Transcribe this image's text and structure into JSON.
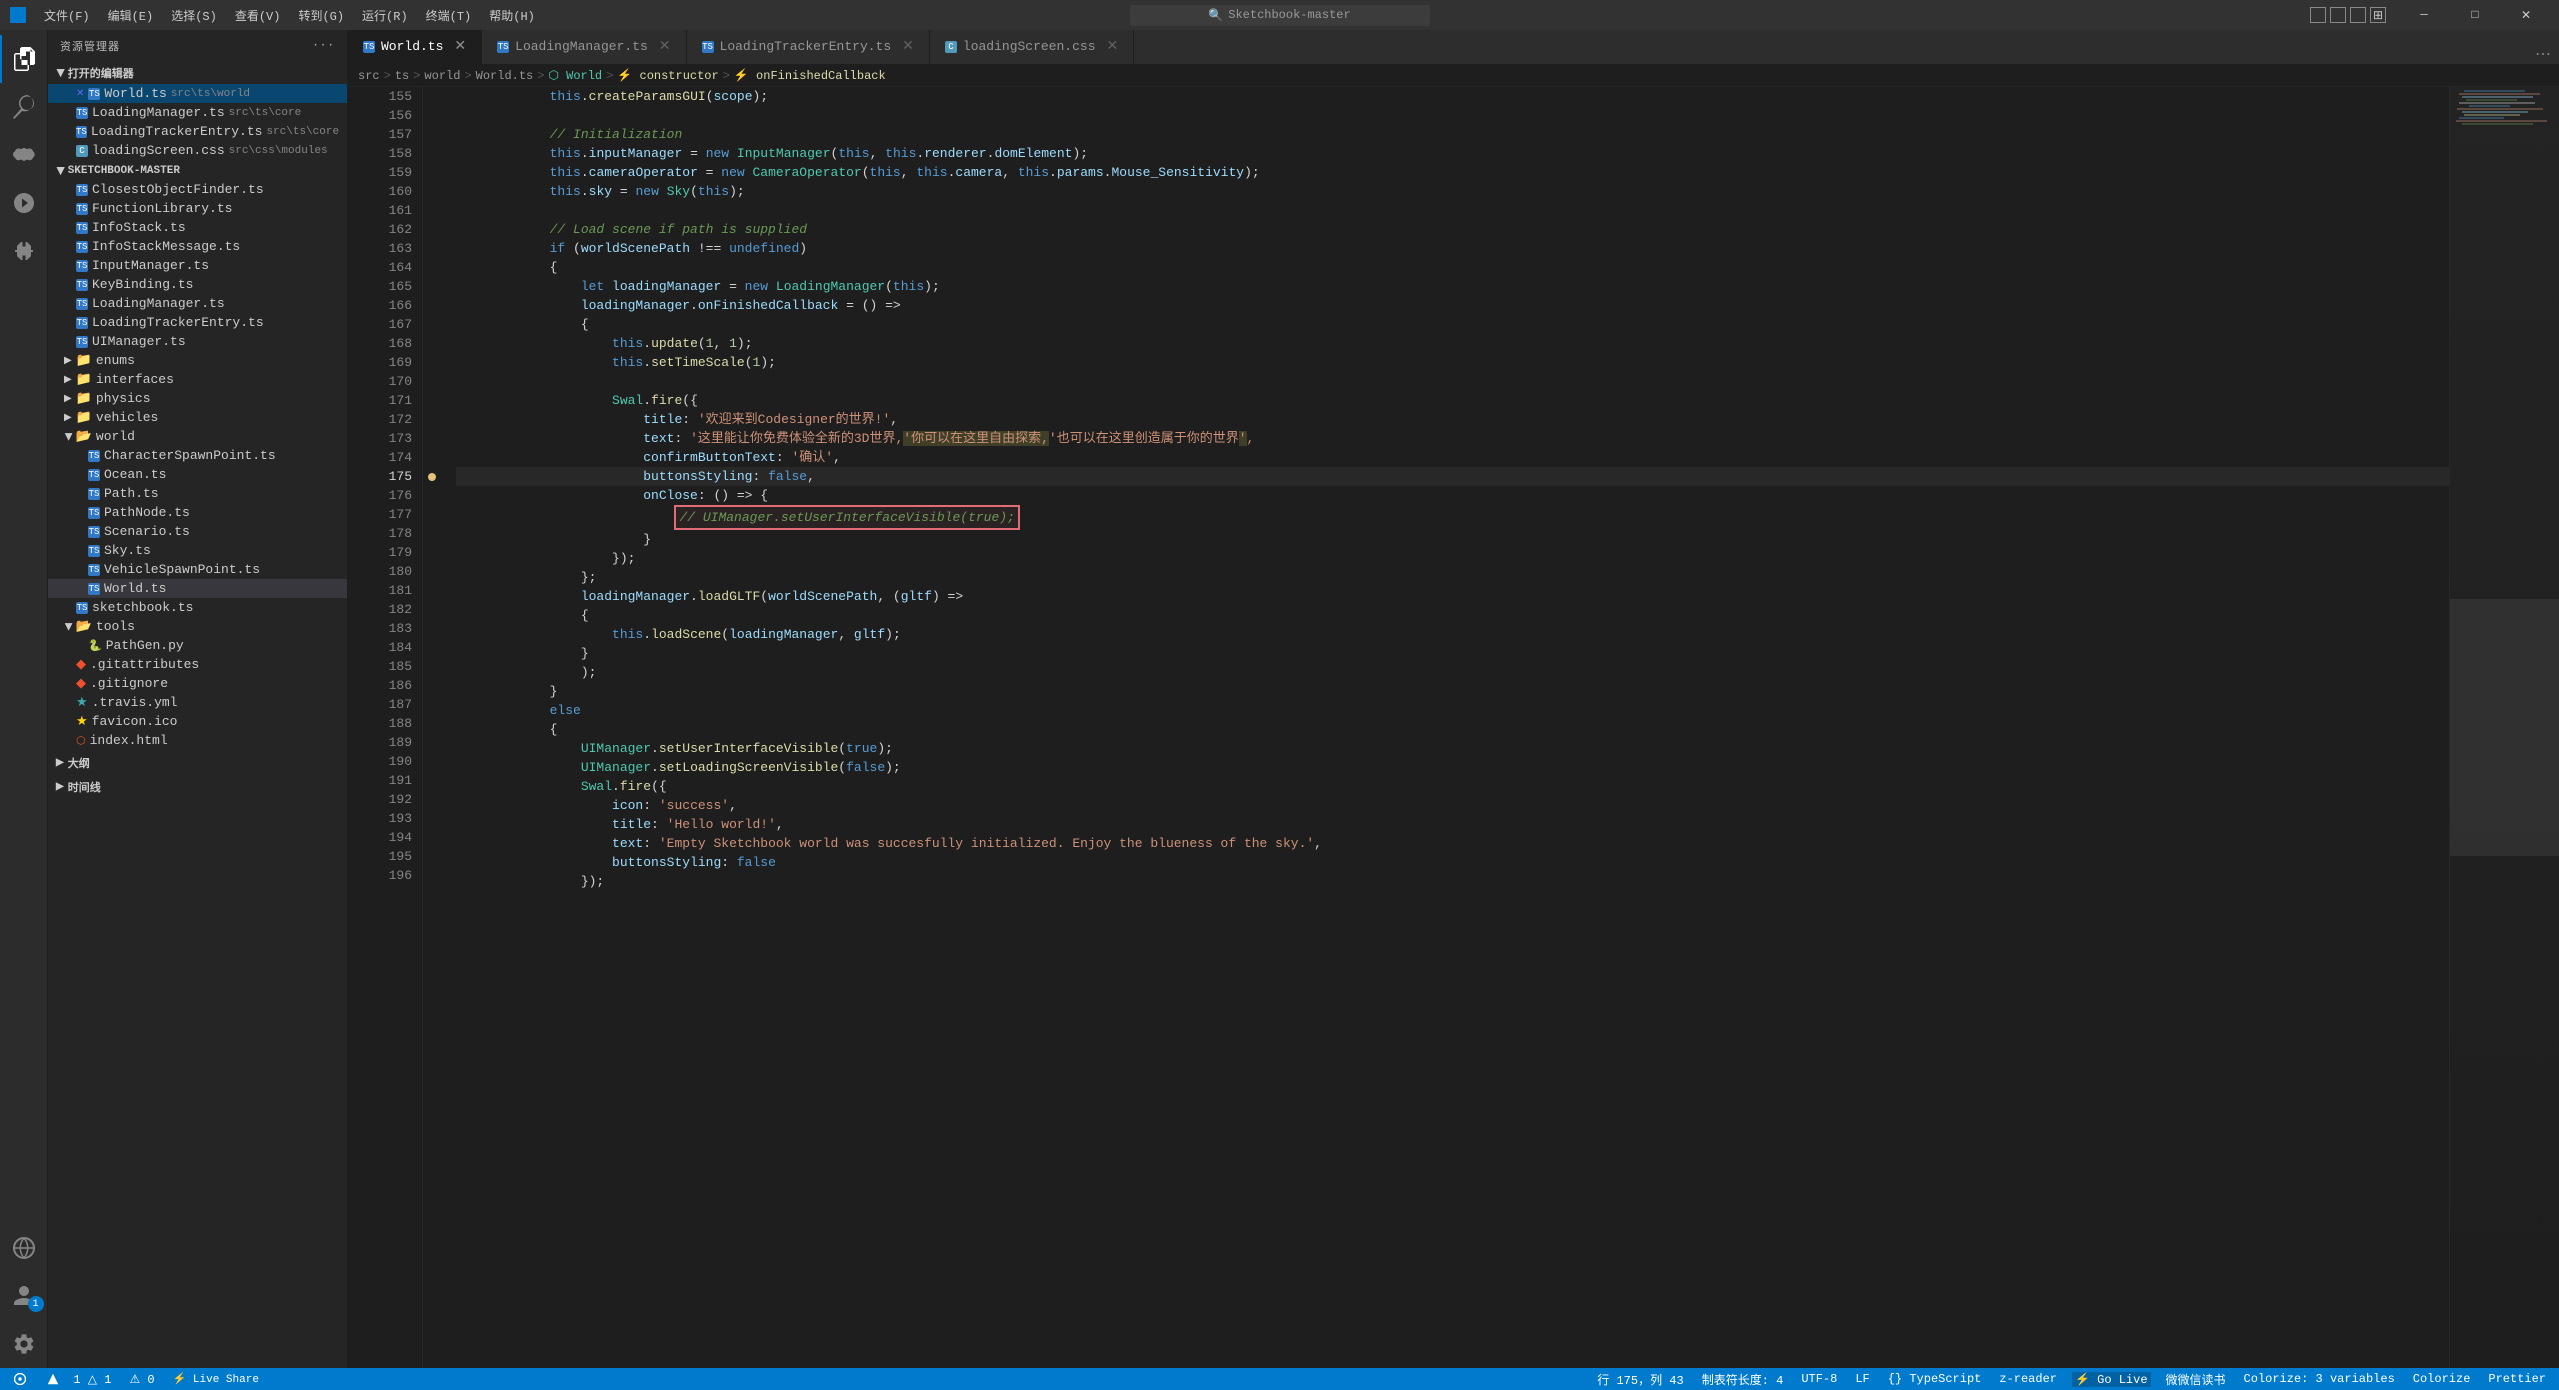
{
  "titlebar": {
    "icon": "VS",
    "menus": [
      "文件(F)",
      "编辑(E)",
      "选择(S)",
      "查看(V)",
      "转到(G)",
      "运行(R)",
      "终端(T)",
      "帮助(H)"
    ],
    "search_placeholder": "Sketchbook-master",
    "window_controls": [
      "─",
      "□",
      "✕"
    ],
    "nav_back": "←",
    "nav_forward": "→"
  },
  "tabs": [
    {
      "id": "world-ts",
      "label": "World.ts",
      "icon_color": "#3178c6",
      "active": true,
      "closeable": true
    },
    {
      "id": "loading-manager",
      "label": "LoadingManager.ts",
      "icon_color": "#3178c6",
      "active": false,
      "closeable": true
    },
    {
      "id": "loading-tracker",
      "label": "LoadingTrackerEntry.ts",
      "icon_color": "#3178c6",
      "active": false,
      "closeable": true
    },
    {
      "id": "loading-screen",
      "label": "loadingScreen.css",
      "icon_color": "#519aba",
      "active": false,
      "closeable": true
    }
  ],
  "breadcrumb": [
    "src",
    ">",
    "ts",
    ">",
    "world",
    ">",
    "World.ts",
    ">",
    "⬡ World",
    ">",
    "⚡ constructor",
    ">",
    "⚡ onFinishedCallback"
  ],
  "sidebar": {
    "title": "资源管理器",
    "more_btn": "···",
    "sections": {
      "open_editors": {
        "label": "打开的编辑器",
        "items": [
          {
            "name": "World.ts",
            "path": "src\\ts\\world",
            "icon_color": "#3178c6",
            "active": true
          },
          {
            "name": "LoadingManager.ts",
            "path": "src\\ts\\core",
            "icon_color": "#3178c6"
          },
          {
            "name": "LoadingTrackerEntry.ts",
            "path": "src\\ts\\core",
            "icon_color": "#3178c6"
          },
          {
            "name": "loadingScreen.css",
            "path": "src\\css\\modules",
            "icon_color": "#519aba"
          }
        ]
      },
      "sketchbook": {
        "label": "SKETCHBOOK-MASTER",
        "folders": [
          {
            "name": "ClosestObjectFinder.ts",
            "indent": 2
          },
          {
            "name": "FunctionLibrary.ts",
            "indent": 2
          },
          {
            "name": "InfoStack.ts",
            "indent": 2
          },
          {
            "name": "InfoStackMessage.ts",
            "indent": 2
          },
          {
            "name": "InputManager.ts",
            "indent": 2
          },
          {
            "name": "KeyBinding.ts",
            "indent": 2
          },
          {
            "name": "LoadingManager.ts",
            "indent": 2
          },
          {
            "name": "LoadingTrackerEntry.ts",
            "indent": 2
          },
          {
            "name": "UIManager.ts",
            "indent": 2
          }
        ],
        "subfolders": [
          {
            "name": "enums",
            "open": false,
            "indent": 1
          },
          {
            "name": "interfaces",
            "open": false,
            "indent": 1
          },
          {
            "name": "physics",
            "open": false,
            "indent": 1
          },
          {
            "name": "vehicles",
            "open": false,
            "indent": 1
          }
        ],
        "world_folder": {
          "name": "world",
          "open": true,
          "indent": 1,
          "items": [
            {
              "name": "CharacterSpawnPoint.ts",
              "indent": 2
            },
            {
              "name": "Ocean.ts",
              "indent": 2
            },
            {
              "name": "Path.ts",
              "indent": 2
            },
            {
              "name": "PathNode.ts",
              "indent": 2
            },
            {
              "name": "Scenario.ts",
              "indent": 2
            },
            {
              "name": "Sky.ts",
              "indent": 2
            },
            {
              "name": "VehicleSpawnPoint.ts",
              "indent": 2
            },
            {
              "name": "World.ts",
              "indent": 2,
              "active": true
            }
          ]
        },
        "other_files": [
          {
            "name": "sketchbook.ts",
            "indent": 1
          }
        ],
        "tools": {
          "name": "tools",
          "open": true,
          "items": [
            {
              "name": "PathGen.py",
              "indent": 2
            },
            {
              "name": ".gitattributes",
              "indent": 1
            },
            {
              "name": ".gitignore",
              "indent": 1
            },
            {
              "name": ".travis.yml",
              "indent": 1
            },
            {
              "name": "favicon.ico",
              "indent": 1
            },
            {
              "name": "index.html",
              "indent": 1
            }
          ]
        },
        "sections_bottom": [
          "大纲",
          "时间线"
        ]
      }
    }
  },
  "code": {
    "lines": [
      {
        "num": 155,
        "content": "createParamsGUI",
        "tokens": [
          {
            "t": "indent",
            "v": "            "
          },
          {
            "t": "this",
            "v": "this"
          },
          {
            "t": "op",
            "v": "."
          },
          {
            "t": "func",
            "v": "createParamsGUI"
          },
          {
            "t": "punc",
            "v": "("
          },
          {
            "t": "var",
            "v": "scope"
          },
          {
            "t": "punc",
            "v": ")"
          }
        ]
      },
      {
        "num": 156,
        "content": ""
      },
      {
        "num": 157,
        "content": "comment_init"
      },
      {
        "num": 158,
        "content": "inputManager"
      },
      {
        "num": 159,
        "content": "cameraOperator"
      },
      {
        "num": 160,
        "content": "sky"
      },
      {
        "num": 161,
        "content": ""
      },
      {
        "num": 162,
        "content": "comment_load"
      },
      {
        "num": 163,
        "content": "if_world"
      },
      {
        "num": 164,
        "content": "brace_open"
      },
      {
        "num": 165,
        "content": "let_loading"
      },
      {
        "num": 166,
        "content": "loadingManager_callback"
      },
      {
        "num": 167,
        "content": "brace_open2"
      },
      {
        "num": 168,
        "content": "update"
      },
      {
        "num": 169,
        "content": "setTimeScale"
      },
      {
        "num": 170,
        "content": ""
      },
      {
        "num": 171,
        "content": "swal_fire"
      },
      {
        "num": 172,
        "content": "title"
      },
      {
        "num": 173,
        "content": "text"
      },
      {
        "num": 174,
        "content": "confirm"
      },
      {
        "num": 175,
        "content": "buttonsStyling",
        "has_dot": true
      },
      {
        "num": 176,
        "content": "onClose"
      },
      {
        "num": 177,
        "content": "comment_ui",
        "red_box": true
      },
      {
        "num": 178,
        "content": "close_brace_red"
      },
      {
        "num": 179,
        "content": "close_paren"
      },
      {
        "num": 180,
        "content": "close_obj"
      },
      {
        "num": 181,
        "content": "loadGLTF"
      },
      {
        "num": 182,
        "content": "brace_open3"
      },
      {
        "num": 183,
        "content": "loadScene"
      },
      {
        "num": 184,
        "content": "close_brace3"
      },
      {
        "num": 185,
        "content": "close_paren2"
      },
      {
        "num": 186,
        "content": "close_brace4"
      },
      {
        "num": 187,
        "content": "else_keyword"
      },
      {
        "num": 188,
        "content": "brace_open5"
      },
      {
        "num": 189,
        "content": "setUserInterfaceVisible"
      },
      {
        "num": 190,
        "content": "setLoadingScreenVisible"
      },
      {
        "num": 191,
        "content": "swal_fire2"
      },
      {
        "num": 192,
        "content": "icon_success"
      },
      {
        "num": 193,
        "content": "title_hello"
      },
      {
        "num": 194,
        "content": "text_empty"
      },
      {
        "num": 195,
        "content": "buttonsStyling2"
      },
      {
        "num": 196,
        "content": "close_swal2"
      }
    ]
  },
  "status_bar": {
    "left": [
      "⎔ 1 △ 1",
      "⚠ 0",
      "Live Share"
    ],
    "right": [
      "行 175，列 43",
      "制表符长度: 4",
      "UTF-8",
      "LF",
      "{} TypeScript",
      "z-reader",
      "Go Live",
      "微微信读书",
      "Colorize: 3 variables",
      "Colorize",
      "Prettier"
    ]
  },
  "activity_icons": [
    {
      "name": "explorer-icon",
      "label": "资源管理器",
      "active": true
    },
    {
      "name": "search-icon",
      "label": "搜索",
      "active": false
    },
    {
      "name": "source-control-icon",
      "label": "源代码管理",
      "active": false
    },
    {
      "name": "run-icon",
      "label": "运行和调试",
      "active": false
    },
    {
      "name": "extensions-icon",
      "label": "扩展",
      "active": false
    },
    {
      "name": "remote-icon",
      "label": "远程",
      "active": false
    },
    {
      "name": "accounts-icon",
      "label": "账户",
      "active": false,
      "has_badge": true,
      "badge": "1"
    }
  ],
  "colors": {
    "bg": "#1e1e1e",
    "sidebar_bg": "#252526",
    "tab_active_bg": "#1e1e1e",
    "tab_inactive_bg": "#2d2d2d",
    "statusbar_bg": "#007acc",
    "accent": "#007acc",
    "keyword": "#569cd6",
    "string": "#ce9178",
    "comment": "#6a9955",
    "func": "#dcdcaa",
    "var": "#9cdcfe",
    "number": "#b5cea8",
    "type": "#4ec9b0",
    "red_highlight": "#e06c75"
  }
}
